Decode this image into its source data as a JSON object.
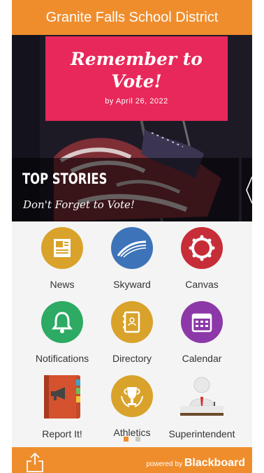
{
  "header": {
    "title": "Granite Falls School District"
  },
  "hero": {
    "vote_title": "Remember to Vote!",
    "vote_subtitle": "by April 26, 2022",
    "section_title": "TOP STORIES",
    "story_title": "Don't Forget to Vote!"
  },
  "tiles": [
    {
      "label": "News",
      "icon": "newspaper-icon",
      "color": "#d9a22b"
    },
    {
      "label": "Skyward",
      "icon": "skyward-icon",
      "color": "#3d73b8"
    },
    {
      "label": "Canvas",
      "icon": "canvas-icon",
      "color": "#c62d38"
    },
    {
      "label": "Notifications",
      "icon": "bell-icon",
      "color": "#2daa63"
    },
    {
      "label": "Directory",
      "icon": "directory-icon",
      "color": "#d9a22b"
    },
    {
      "label": "Calendar",
      "icon": "calendar-icon",
      "color": "#8c38a8"
    },
    {
      "label": "Report It!",
      "icon": "megaphone-book-icon",
      "color": "#c44a2a"
    },
    {
      "label": "Athletics",
      "icon": "trophy-icon",
      "color": "#d9a22b"
    },
    {
      "label": "Superintendent",
      "icon": "superintendent-icon",
      "color": "#d3d3d3"
    }
  ],
  "pager": {
    "page": 1,
    "total": 2
  },
  "footer": {
    "powered_by": "powered by",
    "brand": "Blackboard"
  },
  "colors": {
    "accent": "#ef8d2d",
    "vote_pink": "#e8285a"
  }
}
